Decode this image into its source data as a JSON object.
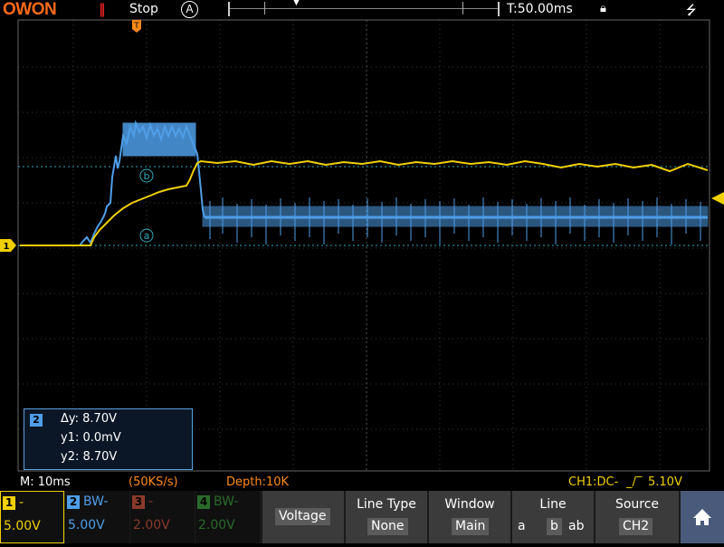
{
  "brand": "OWON",
  "top": {
    "run_state": "Stop",
    "trigger_mode": "A",
    "time_position": "T:50.00ms"
  },
  "measurement": {
    "channel": "2",
    "delta_y": "Δy: 8.70V",
    "y1": "y1: 0.0mV",
    "y2": "y2: 8.70V"
  },
  "cursors": {
    "a": "a",
    "b": "b"
  },
  "status": {
    "timebase": "M: 10ms",
    "sample_rate": "(50KS/s)",
    "depth": "Depth:10K",
    "trigger": "CH1:DC-",
    "trigger_level": "5.10V"
  },
  "channels": [
    {
      "num": "1",
      "coupling": "-",
      "volts_div": "5.00V",
      "color": "#f0d000"
    },
    {
      "num": "2",
      "coupling": "BW-",
      "volts_div": "5.00V",
      "color": "#4f9ee8"
    },
    {
      "num": "3",
      "coupling": "-",
      "volts_div": "2.00V",
      "color": "#8a3a2a"
    },
    {
      "num": "4",
      "coupling": "BW-",
      "volts_div": "2.00V",
      "color": "#2a6a2a"
    }
  ],
  "menu": {
    "voltage": "Voltage",
    "line_type_label": "Line Type",
    "line_type_value": "None",
    "window_label": "Window",
    "window_value": "Main",
    "line_label": "Line",
    "line_a": "a",
    "line_b": "b",
    "line_ab": "ab",
    "source_label": "Source",
    "source_value": "CH2"
  },
  "colors": {
    "ch1": "#f0d000",
    "ch2": "#4f9ee8",
    "cursor": "#2fa9b8",
    "brand": "#ff6a1a"
  }
}
